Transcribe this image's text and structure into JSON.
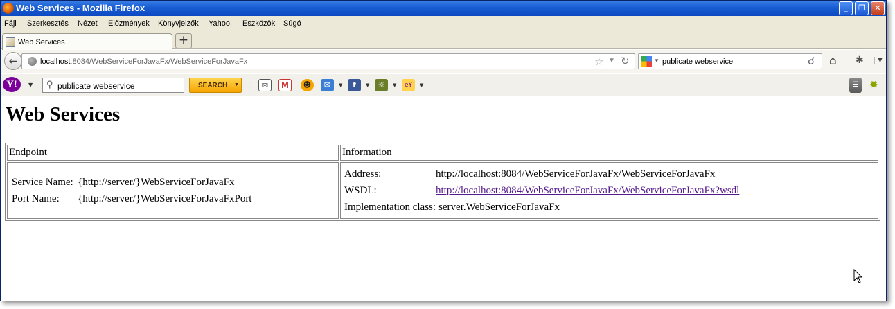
{
  "window": {
    "title": "Web Services - Mozilla Firefox",
    "controls": {
      "minimize": "_",
      "maximize": "❐",
      "close": "✕"
    }
  },
  "menu": [
    "Fájl",
    "Szerkesztés",
    "Nézet",
    "Előzmények",
    "Könyvjelzők",
    "Yahoo!",
    "Eszközök",
    "Súgó"
  ],
  "tab": {
    "label": "Web Services",
    "new_tab": "+"
  },
  "nav": {
    "url_host": "localhost",
    "url_path": ":8084/WebServiceForJavaFx/WebServiceForJavaFx",
    "search_value": "publicate webservice",
    "icons": [
      "back-icon",
      "globe-icon",
      "star-icon",
      "reload-icon",
      "google-icon",
      "search-icon",
      "home-icon",
      "addon-icon"
    ]
  },
  "yahoo_toolbar": {
    "logo": "Y!",
    "search_value": "publicate webservice",
    "search_button": "SEARCH"
  },
  "page": {
    "heading": "Web Services",
    "table": {
      "headers": [
        "Endpoint",
        "Information"
      ],
      "endpoint": {
        "service_label": "Service Name:",
        "service_value": "{http://server/}WebServiceForJavaFx",
        "port_label": "Port Name:",
        "port_value": "{http://server/}WebServiceForJavaFxPort"
      },
      "information": {
        "address_label": "Address:",
        "address_value": "http://localhost:8084/WebServiceForJavaFx/WebServiceForJavaFx",
        "wsdl_label": "WSDL:",
        "wsdl_value": "http://localhost:8084/WebServiceForJavaFx/WebServiceForJavaFx?wsdl",
        "impl_label": "Implementation class:",
        "impl_value": "server.WebServiceForJavaFx"
      }
    }
  },
  "colors": {
    "titlebar": "#1a5fd4",
    "link_visited": "#551a8b",
    "yahoo_purple": "#7b0099",
    "search_button": "#f5a400"
  }
}
